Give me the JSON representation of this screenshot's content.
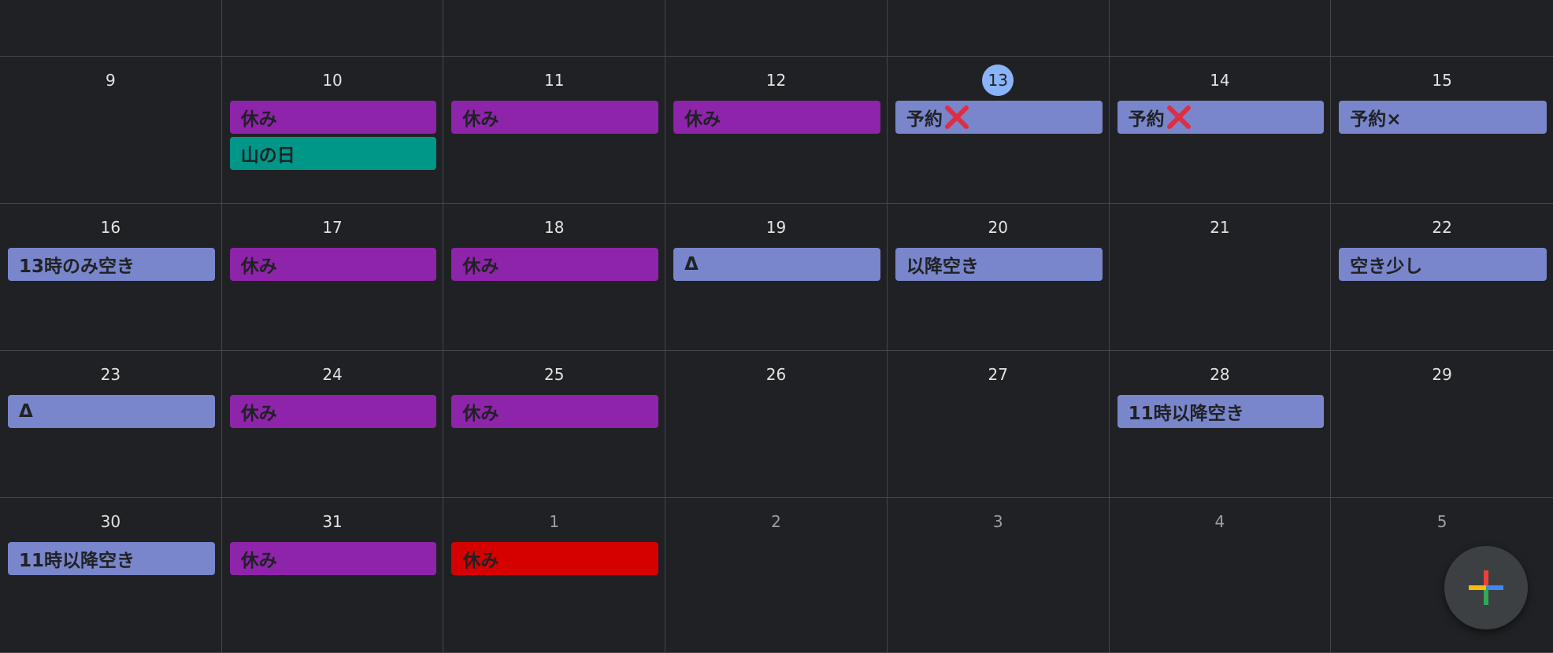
{
  "top_row": {
    "cells": 7
  },
  "weeks": [
    [
      {
        "day": "9",
        "events": []
      },
      {
        "day": "10",
        "events": [
          {
            "label": "休み",
            "color": "#8e24aa"
          },
          {
            "label": "山の日",
            "color": "#009688"
          }
        ]
      },
      {
        "day": "11",
        "events": [
          {
            "label": "休み",
            "color": "#8e24aa"
          }
        ]
      },
      {
        "day": "12",
        "events": [
          {
            "label": "休み",
            "color": "#8e24aa"
          }
        ]
      },
      {
        "day": "13",
        "today": true,
        "events": [
          {
            "label": "予約",
            "color": "#7986cb",
            "icon": "red-cross-mark-icon"
          }
        ]
      },
      {
        "day": "14",
        "events": [
          {
            "label": "予約",
            "color": "#7986cb",
            "icon": "red-cross-mark-icon"
          }
        ]
      },
      {
        "day": "15",
        "events": [
          {
            "label": "予約×",
            "color": "#7986cb"
          }
        ]
      }
    ],
    [
      {
        "day": "16",
        "events": [
          {
            "label": "13時のみ空き",
            "color": "#7986cb"
          }
        ]
      },
      {
        "day": "17",
        "events": [
          {
            "label": "休み",
            "color": "#8e24aa"
          }
        ]
      },
      {
        "day": "18",
        "events": [
          {
            "label": "休み",
            "color": "#8e24aa"
          }
        ]
      },
      {
        "day": "19",
        "events": [
          {
            "label": "Δ",
            "color": "#7986cb"
          }
        ]
      },
      {
        "day": "20",
        "events": [
          {
            "label": "以降空き",
            "color": "#7986cb"
          }
        ]
      },
      {
        "day": "21",
        "events": []
      },
      {
        "day": "22",
        "events": [
          {
            "label": "空き少し",
            "color": "#7986cb"
          }
        ]
      }
    ],
    [
      {
        "day": "23",
        "events": [
          {
            "label": "Δ",
            "color": "#7986cb"
          }
        ]
      },
      {
        "day": "24",
        "events": [
          {
            "label": "休み",
            "color": "#8e24aa"
          }
        ]
      },
      {
        "day": "25",
        "events": [
          {
            "label": "休み",
            "color": "#8e24aa"
          }
        ]
      },
      {
        "day": "26",
        "events": []
      },
      {
        "day": "27",
        "events": []
      },
      {
        "day": "28",
        "events": [
          {
            "label": "11時以降空き",
            "color": "#7986cb"
          }
        ]
      },
      {
        "day": "29",
        "events": []
      }
    ],
    [
      {
        "day": "30",
        "events": [
          {
            "label": "11時以降空き",
            "color": "#7986cb"
          }
        ]
      },
      {
        "day": "31",
        "events": [
          {
            "label": "休み",
            "color": "#8e24aa"
          }
        ]
      },
      {
        "day": "1",
        "other_month": true,
        "events": [
          {
            "label": "休み",
            "color": "#d50000"
          }
        ]
      },
      {
        "day": "2",
        "other_month": true,
        "events": []
      },
      {
        "day": "3",
        "other_month": true,
        "events": []
      },
      {
        "day": "4",
        "other_month": true,
        "events": []
      },
      {
        "day": "5",
        "other_month": true,
        "events": []
      }
    ]
  ],
  "fab": {
    "icon": "colorful-plus-icon",
    "colors": [
      "#ea4335",
      "#4285f4",
      "#34a853",
      "#fbbc04"
    ]
  },
  "colors": {
    "background": "#202124",
    "grid_line": "#44464a",
    "today_circle": "#8ab4f8"
  }
}
